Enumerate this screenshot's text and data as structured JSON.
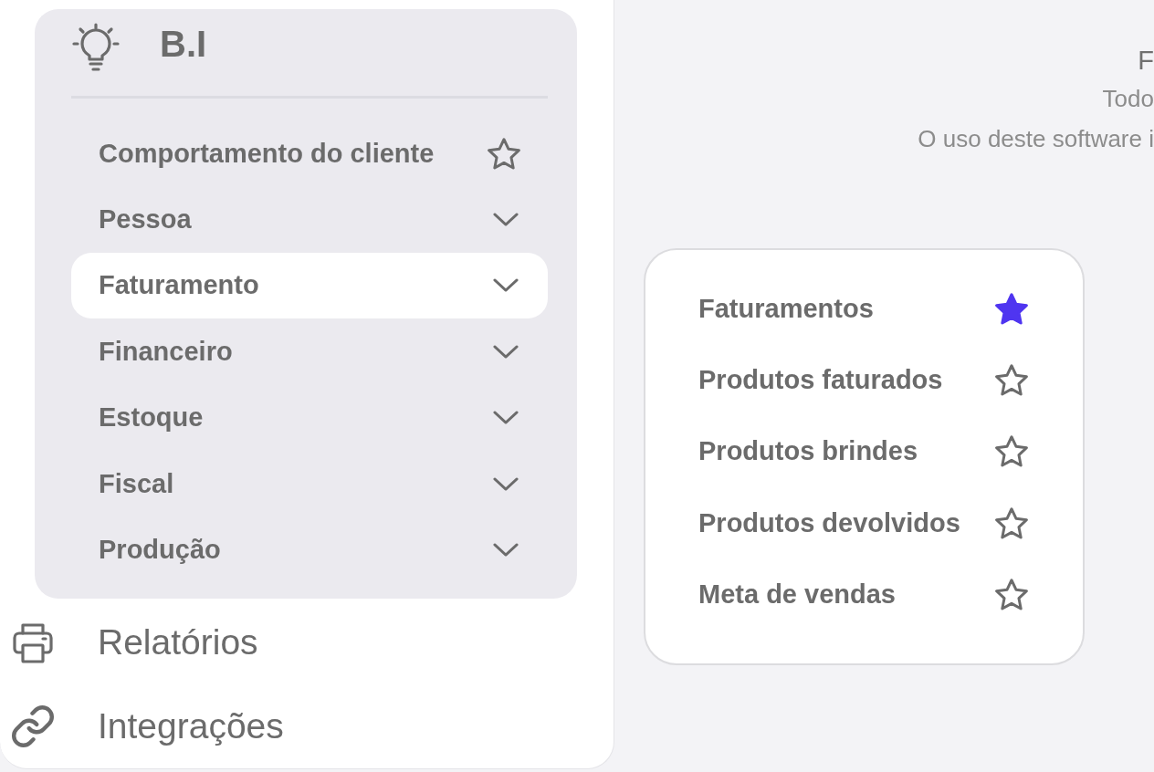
{
  "sidebar": {
    "section": {
      "title": "B.I",
      "items": [
        {
          "label": "Comportamento do cliente",
          "kind": "report",
          "favorite": false,
          "selected": false
        },
        {
          "label": "Pessoa",
          "kind": "group",
          "selected": false
        },
        {
          "label": "Faturamento",
          "kind": "group",
          "selected": true
        },
        {
          "label": "Financeiro",
          "kind": "group",
          "selected": false
        },
        {
          "label": "Estoque",
          "kind": "group",
          "selected": false
        },
        {
          "label": "Fiscal",
          "kind": "group",
          "selected": false
        },
        {
          "label": "Produção",
          "kind": "group",
          "selected": false
        }
      ]
    },
    "nav_items": [
      {
        "label": "Relatórios"
      },
      {
        "label": "Integrações"
      }
    ]
  },
  "footer": {
    "title": "F",
    "lines": [
      "Todo",
      "O uso deste software i"
    ]
  },
  "flyout": {
    "items": [
      {
        "label": "Faturamentos",
        "favorite": true
      },
      {
        "label": "Produtos faturados",
        "favorite": false
      },
      {
        "label": "Produtos brindes",
        "favorite": false
      },
      {
        "label": "Produtos devolvidos",
        "favorite": false
      },
      {
        "label": "Meta de vendas",
        "favorite": false
      }
    ]
  }
}
